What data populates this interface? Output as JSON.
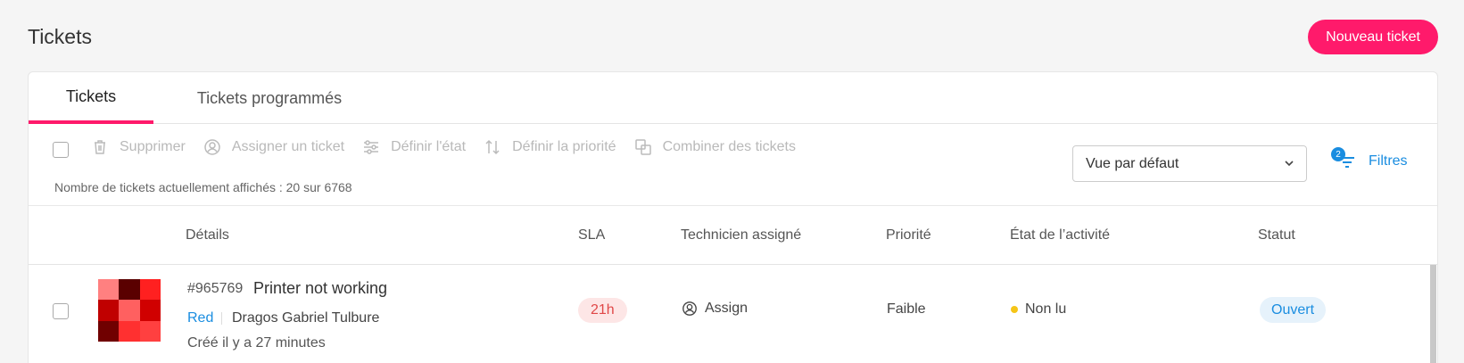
{
  "page": {
    "title": "Tickets",
    "new_ticket_label": "Nouveau ticket"
  },
  "tabs": [
    {
      "label": "Tickets",
      "active": true
    },
    {
      "label": "Tickets programmés",
      "active": false
    }
  ],
  "toolbar": {
    "actions": [
      {
        "label": "Supprimer",
        "icon": "trash-icon"
      },
      {
        "label": "Assigner un ticket",
        "icon": "user-circle-icon"
      },
      {
        "label": "Définir l'état",
        "icon": "sliders-icon"
      },
      {
        "label": "Définir la priorité",
        "icon": "sort-arrows-icon"
      },
      {
        "label": "Combiner des tickets",
        "icon": "merge-icon"
      }
    ],
    "count_text": "Nombre de tickets actuellement affichés : 20 sur 6768",
    "view_select": "Vue par défaut",
    "filters_label": "Filtres",
    "filters_count": "2"
  },
  "columns": {
    "details": "Détails",
    "sla": "SLA",
    "technician": "Technicien assigné",
    "priority": "Priorité",
    "activity": "État de l’activité",
    "status": "Statut"
  },
  "rows": [
    {
      "id": "#965769",
      "title": "Printer not working",
      "tag": "Red",
      "requester": "Dragos Gabriel Tulbure",
      "created": "Créé il y a 27 minutes",
      "sla": "21h",
      "assign_label": "Assign",
      "priority": "Faible",
      "activity": "Non lu",
      "status": "Ouvert",
      "avatar_colors": [
        "#ff8080",
        "#5a0000",
        "#ff2020",
        "#c00000",
        "#ff6060",
        "#d00000",
        "#700000",
        "#ff3030",
        "#ff4040"
      ]
    }
  ],
  "colors": {
    "accent": "#ff1a6b",
    "link": "#1a8de0",
    "sla_text": "#e04848",
    "unread_dot": "#f5c518"
  }
}
